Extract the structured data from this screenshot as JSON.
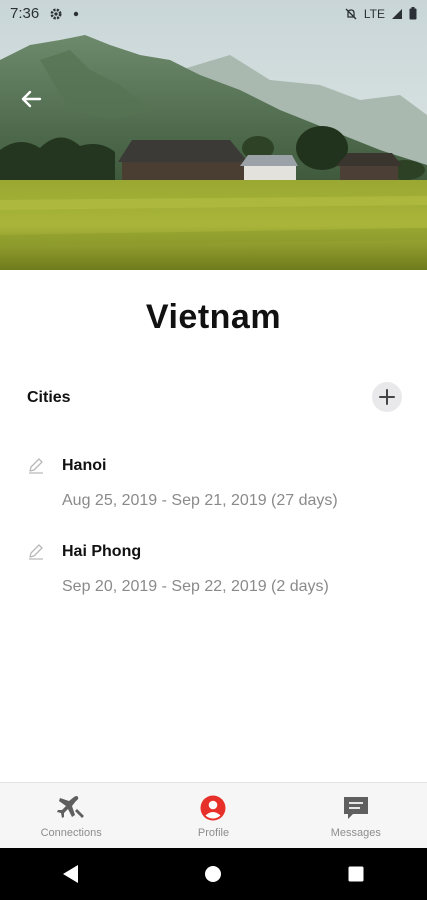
{
  "status_bar": {
    "time": "7:36",
    "network": "LTE",
    "icons": [
      "settings-icon",
      "notification-dot-icon",
      "mute-icon",
      "signal-icon",
      "battery-icon"
    ]
  },
  "hero": {
    "image": "mountain-rice-field-photo",
    "back_icon": "arrow-left-icon"
  },
  "country": {
    "title": "Vietnam"
  },
  "cities": {
    "header": "Cities",
    "add_icon": "plus-icon",
    "items": [
      {
        "name": "Hanoi",
        "dates": "Aug 25, 2019 - Sep 21, 2019 (27 days)",
        "edit_icon": "pencil-icon"
      },
      {
        "name": "Hai Phong",
        "dates": "Sep 20, 2019 - Sep 22, 2019 (2 days)",
        "edit_icon": "pencil-icon"
      }
    ]
  },
  "bottom_nav": {
    "items": [
      {
        "label": "Connections",
        "icon": "airplane-icon"
      },
      {
        "label": "Profile",
        "icon": "profile-icon",
        "active": true
      },
      {
        "label": "Messages",
        "icon": "message-icon"
      }
    ]
  },
  "colors": {
    "accent": "#e8302a",
    "nav_icon": "#5f5f5f",
    "secondary_text": "#8a8a8a"
  }
}
